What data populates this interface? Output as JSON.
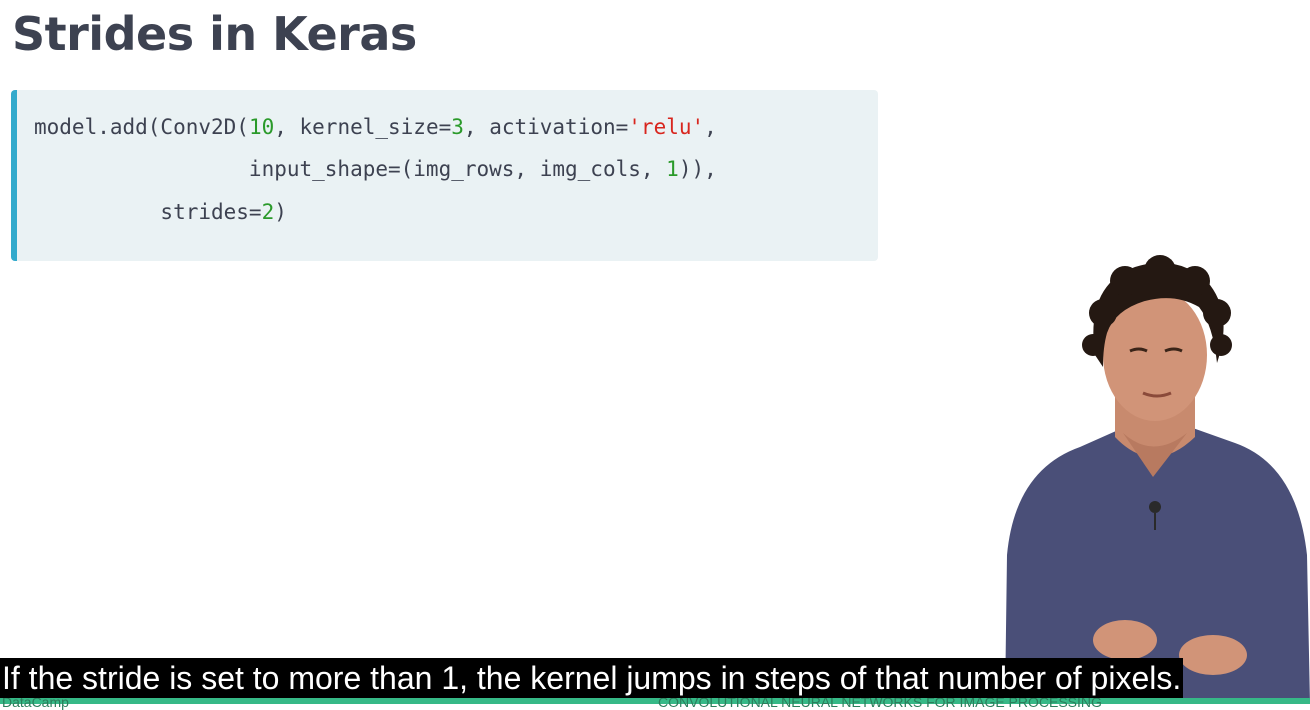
{
  "slide": {
    "title": "Strides in Keras"
  },
  "code": {
    "line1": {
      "a": "model.add(Conv2D(",
      "n1": "10",
      "b": ", kernel_size=",
      "n2": "3",
      "c": ", activation=",
      "s1": "'relu'",
      "d": ","
    },
    "line2": {
      "a": "                 input_shape=(img_rows, img_cols, ",
      "n1": "1",
      "b": ")),"
    },
    "line3": {
      "a": "          strides=",
      "n1": "2",
      "b": ")"
    }
  },
  "caption": {
    "text": "If the stride is set to more than 1, the kernel jumps in steps of that number of pixels."
  },
  "footer": {
    "brand": "DataCamp",
    "course": "CONVOLUTIONAL NEURAL NETWORKS FOR IMAGE PROCESSING"
  },
  "colors": {
    "title": "#3d4251",
    "code_background": "#eaf2f4",
    "code_accent": "#33aacc",
    "code_number": "#2a9a2a",
    "code_string": "#d8261e",
    "footer_bar": "#36b987",
    "caption_background": "#000000",
    "caption_text": "#ffffff"
  }
}
